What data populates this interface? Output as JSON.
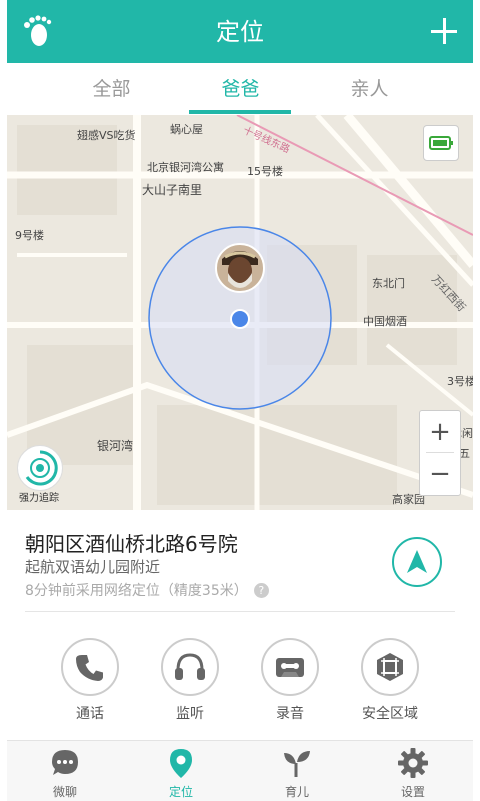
{
  "header": {
    "title": "定位",
    "logo_icon": "footprint-icon",
    "add_icon": "plus-icon"
  },
  "tabs": [
    {
      "label": "全部",
      "active": false
    },
    {
      "label": "爸爸",
      "active": true
    },
    {
      "label": "亲人",
      "active": false
    }
  ],
  "map": {
    "labels": {
      "l1": "翅感VS吃货",
      "l2": "蜗心屋",
      "l3": "北京银河湾公寓",
      "l4": "15号楼",
      "l5": "大山子南里",
      "l6": "9号楼",
      "l7": "东北门",
      "l8": "中国烟酒",
      "l9": "3号楼",
      "l10": "银河湾",
      "l11": "高家园",
      "l12": "万红西街",
      "l13": "十号线东路",
      "l14": "休闲",
      "l15": "五"
    },
    "track_label": "强力追踪",
    "zoom_in": "+",
    "zoom_out": "−",
    "battery_icon": "battery-icon"
  },
  "info": {
    "address": "朝阳区酒仙桥北路6号院",
    "nearby": "起航双语幼儿园附近",
    "accuracy": "8分钟前采用网络定位（精度35米）",
    "help": "?"
  },
  "actions": [
    {
      "label": "通话",
      "icon": "phone-icon"
    },
    {
      "label": "监听",
      "icon": "headphones-icon"
    },
    {
      "label": "录音",
      "icon": "cassette-icon"
    },
    {
      "label": "安全区域",
      "icon": "safe-zone-icon"
    }
  ],
  "bottom_nav": [
    {
      "label": "微聊",
      "icon": "chat-icon",
      "active": false
    },
    {
      "label": "定位",
      "icon": "location-pin-icon",
      "active": true
    },
    {
      "label": "育儿",
      "icon": "sprout-icon",
      "active": false
    },
    {
      "label": "设置",
      "icon": "gear-icon",
      "active": false
    }
  ],
  "colors": {
    "accent": "#21b7a8",
    "map_bg": "#ece8df",
    "circle": "#4a86e8",
    "inactive": "#999999"
  }
}
